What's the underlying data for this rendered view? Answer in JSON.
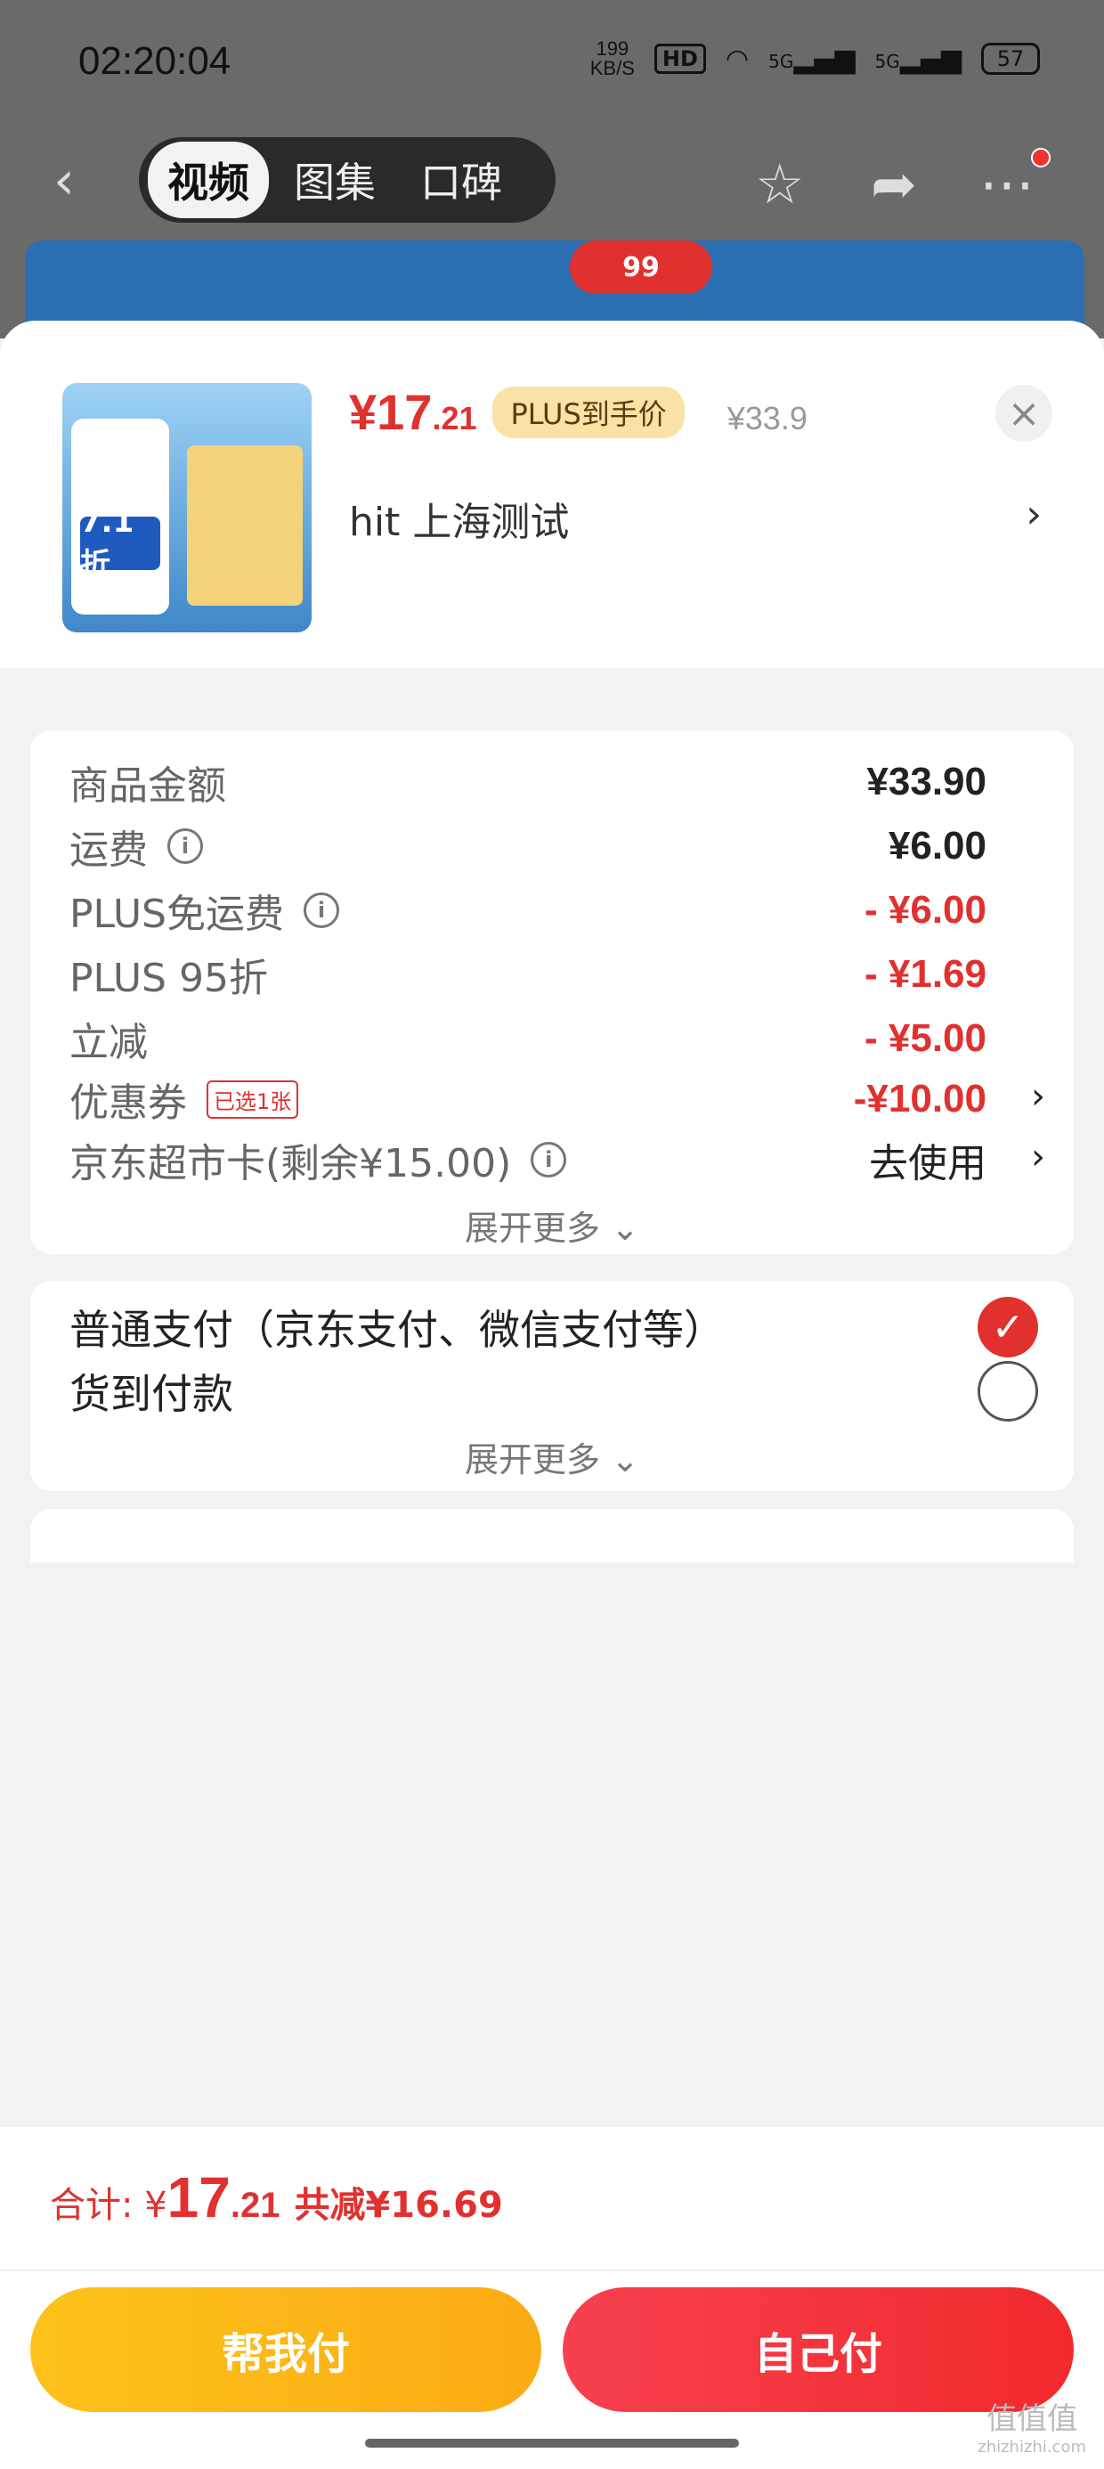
{
  "status_bar": {
    "time": "02:20:04",
    "net_speed_value": "199",
    "net_speed_unit": "KB/S",
    "hd_label": "HD",
    "sim1": "5G",
    "sim2": "5G",
    "battery": "57"
  },
  "top_nav": {
    "tabs": [
      {
        "label": "视频",
        "active": true
      },
      {
        "label": "图集",
        "active": false
      },
      {
        "label": "口碑",
        "active": false
      }
    ],
    "icons": [
      "back-icon",
      "star-icon",
      "share-icon",
      "more-icon"
    ]
  },
  "hero": {
    "badge": "99"
  },
  "product": {
    "price_main": "¥17",
    "price_cents": ".21",
    "plus_tag": "PLUS到手价",
    "original_price": "¥33.9",
    "address": "hit  上海测试",
    "thumb_discount": "7.1折"
  },
  "fees": {
    "rows": [
      {
        "label": "商品金额",
        "value": "¥33.90",
        "red": false
      },
      {
        "label": "运费",
        "value": "¥6.00",
        "red": false
      },
      {
        "label": "PLUS免运费",
        "value": "- ¥6.00",
        "red": true
      },
      {
        "label": "PLUS 95折",
        "value": "- ¥1.69",
        "red": true
      },
      {
        "label": "立减",
        "value": "- ¥5.00",
        "red": true
      },
      {
        "label": "优惠券",
        "tag": "已选1张",
        "value": "-¥10.00",
        "red": true
      },
      {
        "label": "京东超市卡(剩余¥15.00)",
        "value": "去使用",
        "red": false
      }
    ],
    "expand_more": "展开更多"
  },
  "payment": {
    "options": [
      {
        "label": "普通支付（京东支付、微信支付等）",
        "selected": true
      },
      {
        "label": "货到付款",
        "selected": false
      }
    ],
    "expand_more": "展开更多"
  },
  "footer": {
    "total_label": "合计: ¥",
    "total_big": "17",
    "total_small": ".21",
    "savings": "共减¥16.69",
    "help_pay_label": "帮我付",
    "self_pay_label": "自己付"
  },
  "watermark": {
    "text": "值值值",
    "sub": "zhizhizhi.com"
  },
  "colors": {
    "accent": "#e0312f",
    "gold": "#fdc21c"
  }
}
